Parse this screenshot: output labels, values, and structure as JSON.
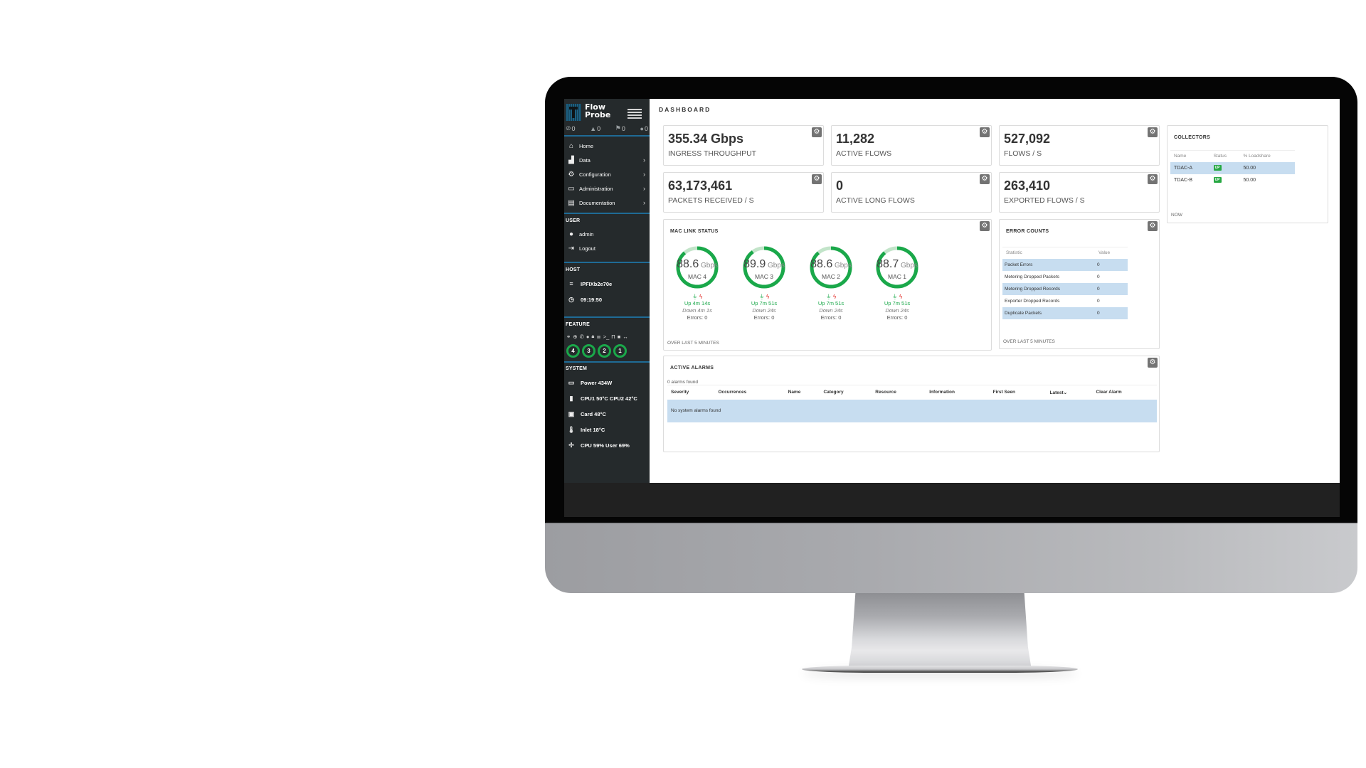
{
  "app": {
    "brand_line1": "Flow",
    "brand_line2": "Probe",
    "page_title": "DASHBOARD"
  },
  "sidebar": {
    "alert_counts": [
      {
        "icon": "blocked-icon",
        "glyph": "⊘",
        "value": "0"
      },
      {
        "icon": "warning-icon",
        "glyph": "▲",
        "value": "0"
      },
      {
        "icon": "flag-icon",
        "glyph": "⚑",
        "value": "0"
      },
      {
        "icon": "info-icon",
        "glyph": "●",
        "value": "0"
      }
    ],
    "nav": [
      {
        "label": "Home",
        "icon": "home-icon",
        "glyph": "⌂",
        "has_children": false
      },
      {
        "label": "Data",
        "icon": "chart-icon",
        "glyph": "▟",
        "has_children": true
      },
      {
        "label": "Configuration",
        "icon": "cogs-icon",
        "glyph": "⚙",
        "has_children": true
      },
      {
        "label": "Administration",
        "icon": "laptop-icon",
        "glyph": "▭",
        "has_children": true
      },
      {
        "label": "Documentation",
        "icon": "book-icon",
        "glyph": "▤",
        "has_children": true
      }
    ],
    "chevron": "›",
    "user": {
      "heading": "USER",
      "items": [
        {
          "label": "admin",
          "icon": "user-icon",
          "glyph": "●"
        },
        {
          "label": "Logout",
          "icon": "logout-icon",
          "glyph": "⇥"
        }
      ]
    },
    "host": {
      "heading": "HOST",
      "items": [
        {
          "label": "IPFIXb2e70e",
          "icon": "server-icon",
          "glyph": "≡"
        },
        {
          "label": "09:19:50",
          "icon": "clock-icon",
          "glyph": "◷"
        }
      ]
    },
    "feature": {
      "heading": "FEATURE",
      "icons": [
        {
          "name": "link-icon",
          "glyph": "⚭"
        },
        {
          "name": "globe-icon",
          "glyph": "⊕"
        },
        {
          "name": "phone-icon",
          "glyph": "✆"
        },
        {
          "name": "circle-icon",
          "glyph": "●"
        },
        {
          "name": "lock-icon",
          "glyph": "🔒︎"
        },
        {
          "name": "list-icon",
          "glyph": "≣"
        },
        {
          "name": "terminal-icon",
          "glyph": ">_"
        },
        {
          "name": "gate-icon",
          "glyph": "Π"
        },
        {
          "name": "square-icon",
          "glyph": "■"
        },
        {
          "name": "arrows-icon",
          "glyph": "↔"
        }
      ],
      "mac_rings": [
        "4",
        "3",
        "2",
        "1"
      ]
    },
    "system": {
      "heading": "SYSTEM",
      "items": [
        {
          "label": "Power 434W",
          "icon": "battery-icon",
          "glyph": "▭"
        },
        {
          "label": "CPU1 50°C CPU2 42°C",
          "icon": "cpu-icon",
          "glyph": "▮"
        },
        {
          "label": "Card 48°C",
          "icon": "card-icon",
          "glyph": "▣"
        },
        {
          "label": "Inlet 18°C",
          "icon": "thermometer-icon",
          "glyph": "🌡︎"
        },
        {
          "label": "CPU 59% User 69%",
          "icon": "fan-icon",
          "glyph": "✢"
        }
      ]
    }
  },
  "stats": [
    {
      "value": "355.34 Gbps",
      "label": "INGRESS THROUGHPUT"
    },
    {
      "value": "11,282",
      "label": "ACTIVE FLOWS"
    },
    {
      "value": "527,092",
      "label": "FLOWS / S"
    },
    {
      "value": "63,173,461",
      "label": "PACKETS RECEIVED / S"
    },
    {
      "value": "0",
      "label": "ACTIVE LONG FLOWS"
    },
    {
      "value": "263,410",
      "label": "EXPORTED FLOWS / S"
    }
  ],
  "mac_link_status": {
    "title": "MAC LINK STATUS",
    "footer": "OVER LAST 5 MINUTES",
    "unit": "Gbps",
    "capacity_gbps": 100,
    "links": [
      {
        "name": "MAC 4",
        "value": "88.6",
        "up": "Up 4m 14s",
        "down": "Down 4m 1s",
        "errors": "Errors: 0"
      },
      {
        "name": "MAC 3",
        "value": "89.9",
        "up": "Up 7m 51s",
        "down": "Down 24s",
        "errors": "Errors: 0"
      },
      {
        "name": "MAC 2",
        "value": "88.6",
        "up": "Up 7m 51s",
        "down": "Down 24s",
        "errors": "Errors: 0"
      },
      {
        "name": "MAC 1",
        "value": "88.7",
        "up": "Up 7m 51s",
        "down": "Down 24s",
        "errors": "Errors: 0"
      }
    ],
    "colors": {
      "ring": "#1aa84a",
      "ring_track": "#c2e4c9"
    }
  },
  "error_counts": {
    "title": "ERROR COUNTS",
    "footer": "OVER LAST 5 MINUTES",
    "columns": [
      "Statistic",
      "Value"
    ],
    "rows": [
      {
        "statistic": "Packet Errors",
        "value": "0"
      },
      {
        "statistic": "Metering Dropped Packets",
        "value": "0"
      },
      {
        "statistic": "Metering Dropped Records",
        "value": "0"
      },
      {
        "statistic": "Exporter Dropped Records",
        "value": "0"
      },
      {
        "statistic": "Duplicate Packets",
        "value": "0"
      }
    ]
  },
  "collectors": {
    "title": "COLLECTORS",
    "footer": "NOW",
    "columns": [
      "Name",
      "Status",
      "% Loadshare"
    ],
    "rows": [
      {
        "name": "TDAC-A",
        "status": "UP",
        "loadshare": "50.00"
      },
      {
        "name": "TDAC-B",
        "status": "UP",
        "loadshare": "50.00"
      }
    ]
  },
  "active_alarms": {
    "title": "ACTIVE ALARMS",
    "summary": "0 alarms found",
    "columns": [
      "Severity",
      "Occurrences",
      "Name",
      "Category",
      "Resource",
      "Information",
      "First Seen",
      "Latest⌄",
      "Clear Alarm"
    ],
    "empty_message": "No system alarms found"
  }
}
